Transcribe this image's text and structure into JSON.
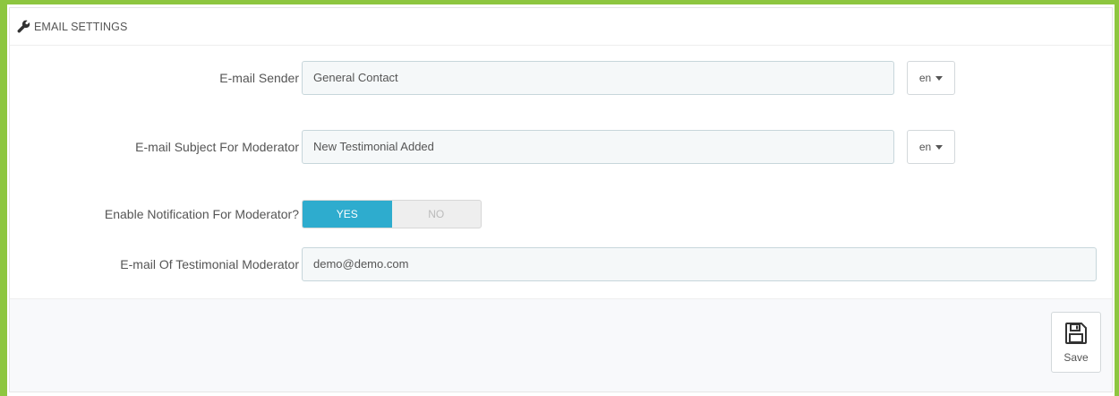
{
  "panel": {
    "title": "EMAIL SETTINGS",
    "icon": "wrench-icon"
  },
  "fields": {
    "sender": {
      "label": "E-mail Sender",
      "value": "General Contact",
      "lang": "en"
    },
    "subject": {
      "label": "E-mail Subject For Moderator",
      "value": "New Testimonial Added",
      "lang": "en"
    },
    "notification": {
      "label": "Enable Notification For Moderator?",
      "yes": "YES",
      "no": "NO",
      "selected": "YES"
    },
    "moderator_email": {
      "label": "E-mail Of Testimonial Moderator",
      "value": "demo@demo.com"
    }
  },
  "footer": {
    "save_label": "Save",
    "save_icon": "floppy-disk-icon"
  },
  "colors": {
    "frame_border": "#8dc63f",
    "toggle_active": "#2eacce",
    "input_bg": "#f5f8f9"
  }
}
